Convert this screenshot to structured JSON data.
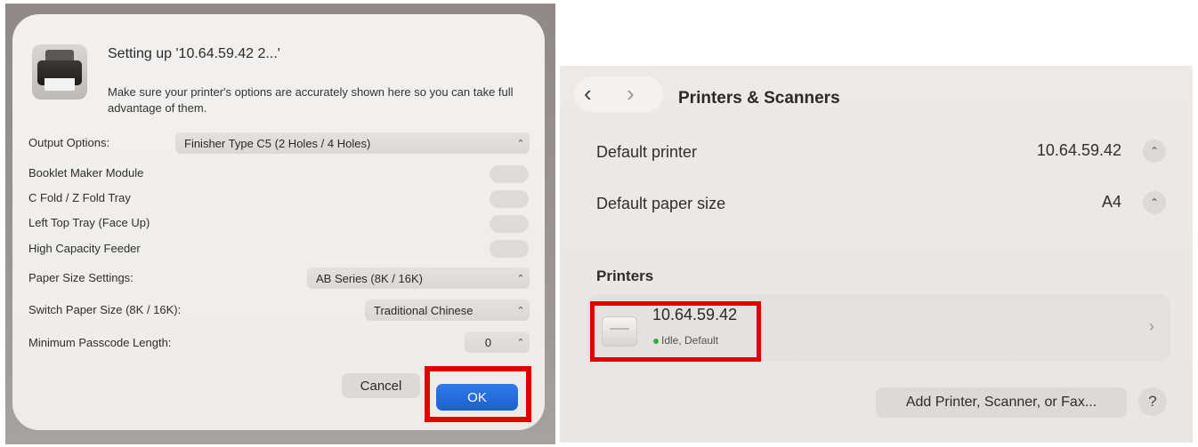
{
  "setup_dialog": {
    "title": "Setting up '10.64.59.42 2...'",
    "description": "Make sure your printer's options are accurately shown here so you can take full advantage of them.",
    "output_options": {
      "label": "Output Options:",
      "value": "Finisher Type C5 (2 Holes / 4 Holes)"
    },
    "toggles": [
      {
        "label": "Booklet Maker Module",
        "on": false
      },
      {
        "label": "C Fold / Z Fold Tray",
        "on": false
      },
      {
        "label": "Left Top Tray (Face Up)",
        "on": false
      },
      {
        "label": "High Capacity Feeder",
        "on": false
      }
    ],
    "paper_size_settings": {
      "label": "Paper Size Settings:",
      "value": "AB Series (8K / 16K)"
    },
    "switch_paper_size": {
      "label": "Switch Paper Size (8K / 16K):",
      "value": "Traditional Chinese"
    },
    "min_passcode": {
      "label": "Minimum Passcode Length:",
      "value": "0"
    },
    "cancel_label": "Cancel",
    "ok_label": "OK",
    "stepper_glyph": "⌃⌄"
  },
  "printers_panel": {
    "back_glyph": "‹",
    "forward_glyph": "›",
    "title": "Printers & Scanners",
    "default_printer": {
      "label": "Default printer",
      "value": "10.64.59.42"
    },
    "default_paper": {
      "label": "Default paper size",
      "value": "A4"
    },
    "section_title": "Printers",
    "printer": {
      "name": "10.64.59.42",
      "status": "Idle, Default",
      "status_color": "#2eae3c"
    },
    "add_label": "Add Printer, Scanner, or Fax...",
    "help_label": "?",
    "chevron": "›"
  },
  "colors": {
    "highlight": "#e00000",
    "accent_blue": "#1e5fcf"
  }
}
